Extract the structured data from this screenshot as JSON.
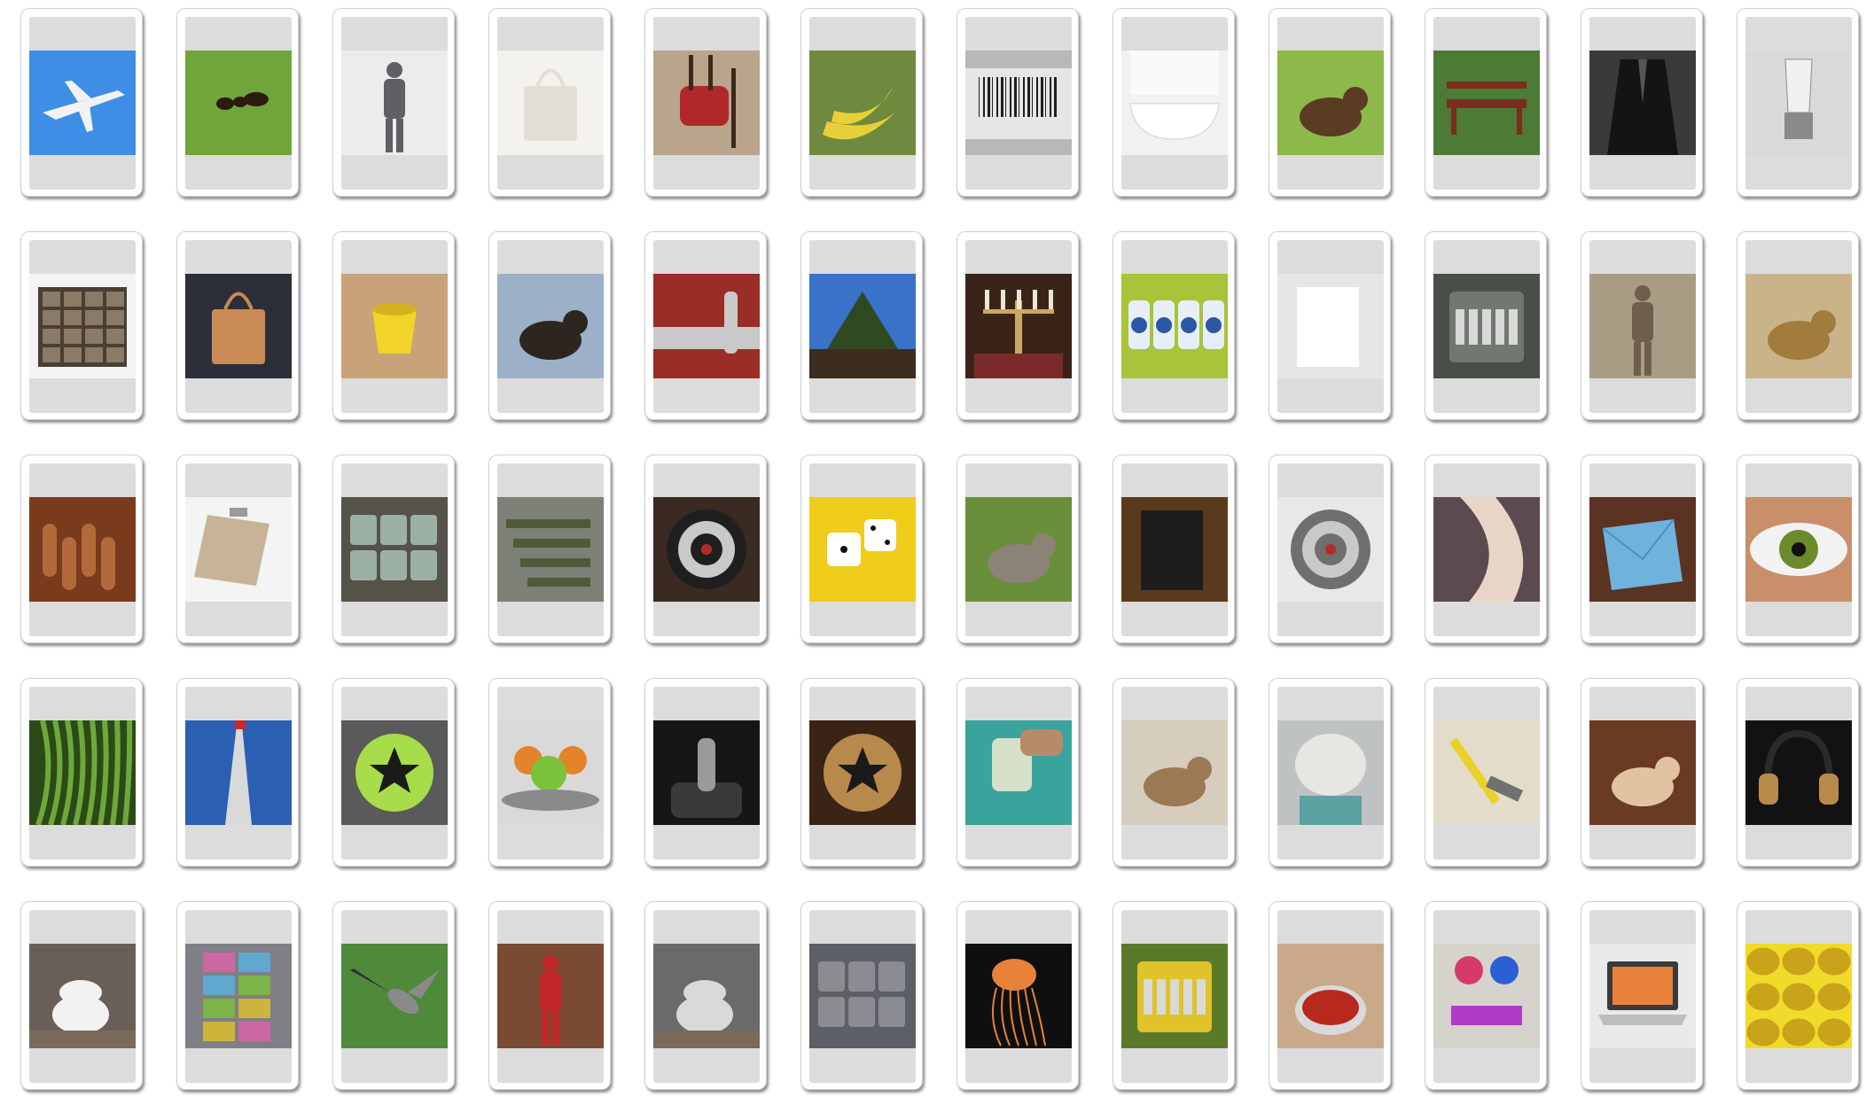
{
  "cards": [
    {
      "subject": "airplane",
      "bg": "#3f8ee6",
      "fg": "#f2f2f2",
      "shape": "plane"
    },
    {
      "subject": "ant",
      "bg": "#6fa53a",
      "fg": "#2a1a10",
      "shape": "bug"
    },
    {
      "subject": "armour",
      "bg": "#ececec",
      "fg": "#5e6065",
      "shape": "figure"
    },
    {
      "subject": "bag",
      "bg": "#f3f2ee",
      "fg": "#e2ded5",
      "shape": "bag"
    },
    {
      "subject": "bagpipe",
      "bg": "#b9a58c",
      "fg": "#b0282a",
      "shape": "pipes"
    },
    {
      "subject": "banana",
      "bg": "#6f8a3e",
      "fg": "#e8cf3a",
      "shape": "banana"
    },
    {
      "subject": "barcode",
      "bg": "#b8b8b8",
      "fg": "#1f1f1f",
      "shape": "barcode"
    },
    {
      "subject": "bathtub",
      "bg": "#f1f1f1",
      "fg": "#ffffff",
      "shape": "tub"
    },
    {
      "subject": "beaver",
      "bg": "#8db94a",
      "fg": "#5a3b23",
      "shape": "animal"
    },
    {
      "subject": "bench",
      "bg": "#4d7a35",
      "fg": "#7a2d1c",
      "shape": "bench"
    },
    {
      "subject": "blazer",
      "bg": "#3a3a3a",
      "fg": "#141414",
      "shape": "coat"
    },
    {
      "subject": "blender",
      "bg": "#d9d9d9",
      "fg": "#8a8a8a",
      "shape": "blender"
    },
    {
      "subject": "bookcase",
      "bg": "#f3f3f3",
      "fg": "#4a3f33",
      "shape": "shelves"
    },
    {
      "subject": "briefcase",
      "bg": "#2c2f3a",
      "fg": "#c98a55",
      "shape": "bag"
    },
    {
      "subject": "bucket",
      "bg": "#c8a37a",
      "fg": "#f1d32a",
      "shape": "bucket"
    },
    {
      "subject": "bull",
      "bg": "#9cb0c8",
      "fg": "#2d2520",
      "shape": "animal"
    },
    {
      "subject": "bumper",
      "bg": "#9a2d26",
      "fg": "#c9c9c9",
      "shape": "bumper"
    },
    {
      "subject": "bush",
      "bg": "#3a71c9",
      "fg": "#3b2c1e",
      "shape": "tree"
    },
    {
      "subject": "candelabra",
      "bg": "#3a2318",
      "fg": "#c9a867",
      "shape": "candle"
    },
    {
      "subject": "canister",
      "bg": "#a7c43a",
      "fg": "#2c56a6",
      "shape": "jars"
    },
    {
      "subject": "canvas",
      "bg": "#e6e6e6",
      "fg": "#ffffff",
      "shape": "panel"
    },
    {
      "subject": "cash register",
      "bg": "#4a4e48",
      "fg": "#707870",
      "shape": "machine"
    },
    {
      "subject": "chariot",
      "bg": "#a99c84",
      "fg": "#6e5f4a",
      "shape": "figure"
    },
    {
      "subject": "cheetah",
      "bg": "#c9b48a",
      "fg": "#a27c3c",
      "shape": "animal"
    },
    {
      "subject": "cinnamon",
      "bg": "#7a3a1c",
      "fg": "#b36a3a",
      "shape": "sticks"
    },
    {
      "subject": "clipboard",
      "bg": "#f4f4f4",
      "fg": "#c7b498",
      "shape": "clipboard"
    },
    {
      "subject": "coaster",
      "bg": "#55524a",
      "fg": "#9cb0a5",
      "shape": "pile"
    },
    {
      "subject": "cot",
      "bg": "#7d8076",
      "fg": "#4f5a3a",
      "shape": "rows"
    },
    {
      "subject": "dartboard",
      "bg": "#3a2a22",
      "fg": "#1f1f1f",
      "shape": "target"
    },
    {
      "subject": "dice",
      "bg": "#f0cc1b",
      "fg": "#ffffff",
      "shape": "dice"
    },
    {
      "subject": "donkey",
      "bg": "#6a8f3a",
      "fg": "#8b8378",
      "shape": "animal"
    },
    {
      "subject": "doormat",
      "bg": "#5a3a1d",
      "fg": "#1d1d1d",
      "shape": "panel"
    },
    {
      "subject": "drain",
      "bg": "#e8e8e8",
      "fg": "#6f6f6f",
      "shape": "target"
    },
    {
      "subject": "elbow",
      "bg": "#5b4a4f",
      "fg": "#e9d5c8",
      "shape": "arm"
    },
    {
      "subject": "envelope",
      "bg": "#5a3322",
      "fg": "#6fb3dd",
      "shape": "envelope"
    },
    {
      "subject": "eye",
      "bg": "#c98f6b",
      "fg": "#6b8a2a",
      "shape": "eye"
    },
    {
      "subject": "fern",
      "bg": "#2c4a18",
      "fg": "#6fa83a",
      "shape": "fern"
    },
    {
      "subject": "flagpole",
      "bg": "#2a5fb3",
      "fg": "#d9d9d9",
      "shape": "pole"
    },
    {
      "subject": "frisbee",
      "bg": "#5a5a5a",
      "fg": "#a7dc4a",
      "shape": "disc"
    },
    {
      "subject": "fruit",
      "bg": "#d9d9d9",
      "fg": "#e3832a",
      "shape": "fruitbowl"
    },
    {
      "subject": "gearshift",
      "bg": "#161616",
      "fg": "#9a9a9a",
      "shape": "stick"
    },
    {
      "subject": "globe",
      "bg": "#3a2416",
      "fg": "#b78a4c",
      "shape": "disc"
    },
    {
      "subject": "glue",
      "bg": "#3aa39c",
      "fg": "#d7e0c8",
      "shape": "bottle"
    },
    {
      "subject": "groundhog",
      "bg": "#d6cdbd",
      "fg": "#9a7a55",
      "shape": "animal"
    },
    {
      "subject": "hairnet",
      "bg": "#bfc2c3",
      "fg": "#e7e6e2",
      "shape": "head"
    },
    {
      "subject": "hammer",
      "bg": "#e4dccb",
      "fg": "#e8d22a",
      "shape": "hammer"
    },
    {
      "subject": "hamster",
      "bg": "#6b3a22",
      "fg": "#e1c3a2",
      "shape": "animal"
    },
    {
      "subject": "headphones",
      "bg": "#121212",
      "fg": "#b88a4a",
      "shape": "headphones"
    },
    {
      "subject": "honey",
      "bg": "#6a5f58",
      "fg": "#f2f2f2",
      "shape": "pot"
    },
    {
      "subject": "hopscotch",
      "bg": "#7f7f85",
      "fg": "#e063a8",
      "shape": "grid"
    },
    {
      "subject": "hummingbird",
      "bg": "#4f8a3a",
      "fg": "#8a8a8a",
      "shape": "bird"
    },
    {
      "subject": "jackhammer",
      "bg": "#7a4a32",
      "fg": "#c2282a",
      "shape": "figure"
    },
    {
      "subject": "jar",
      "bg": "#6a6a6a",
      "fg": "#d9d9d9",
      "shape": "pot"
    },
    {
      "subject": "jeans",
      "bg": "#5c5f66",
      "fg": "#8a8c92",
      "shape": "pile"
    },
    {
      "subject": "jellyfish",
      "bg": "#0f0f0f",
      "fg": "#e8823a",
      "shape": "jelly"
    },
    {
      "subject": "jukebox",
      "bg": "#5a7a2a",
      "fg": "#e0c22a",
      "shape": "machine"
    },
    {
      "subject": "ketchup",
      "bg": "#c9a98a",
      "fg": "#b8281c",
      "shape": "bowl"
    },
    {
      "subject": "knitting",
      "bg": "#d6d2cc",
      "fg": "#d63a6a",
      "shape": "yarn"
    },
    {
      "subject": "laptop",
      "bg": "#e9e9e9",
      "fg": "#3a3a3a",
      "shape": "laptop"
    },
    {
      "subject": "lemon",
      "bg": "#f0da2a",
      "fg": "#c9a31a",
      "shape": "lemons"
    }
  ]
}
